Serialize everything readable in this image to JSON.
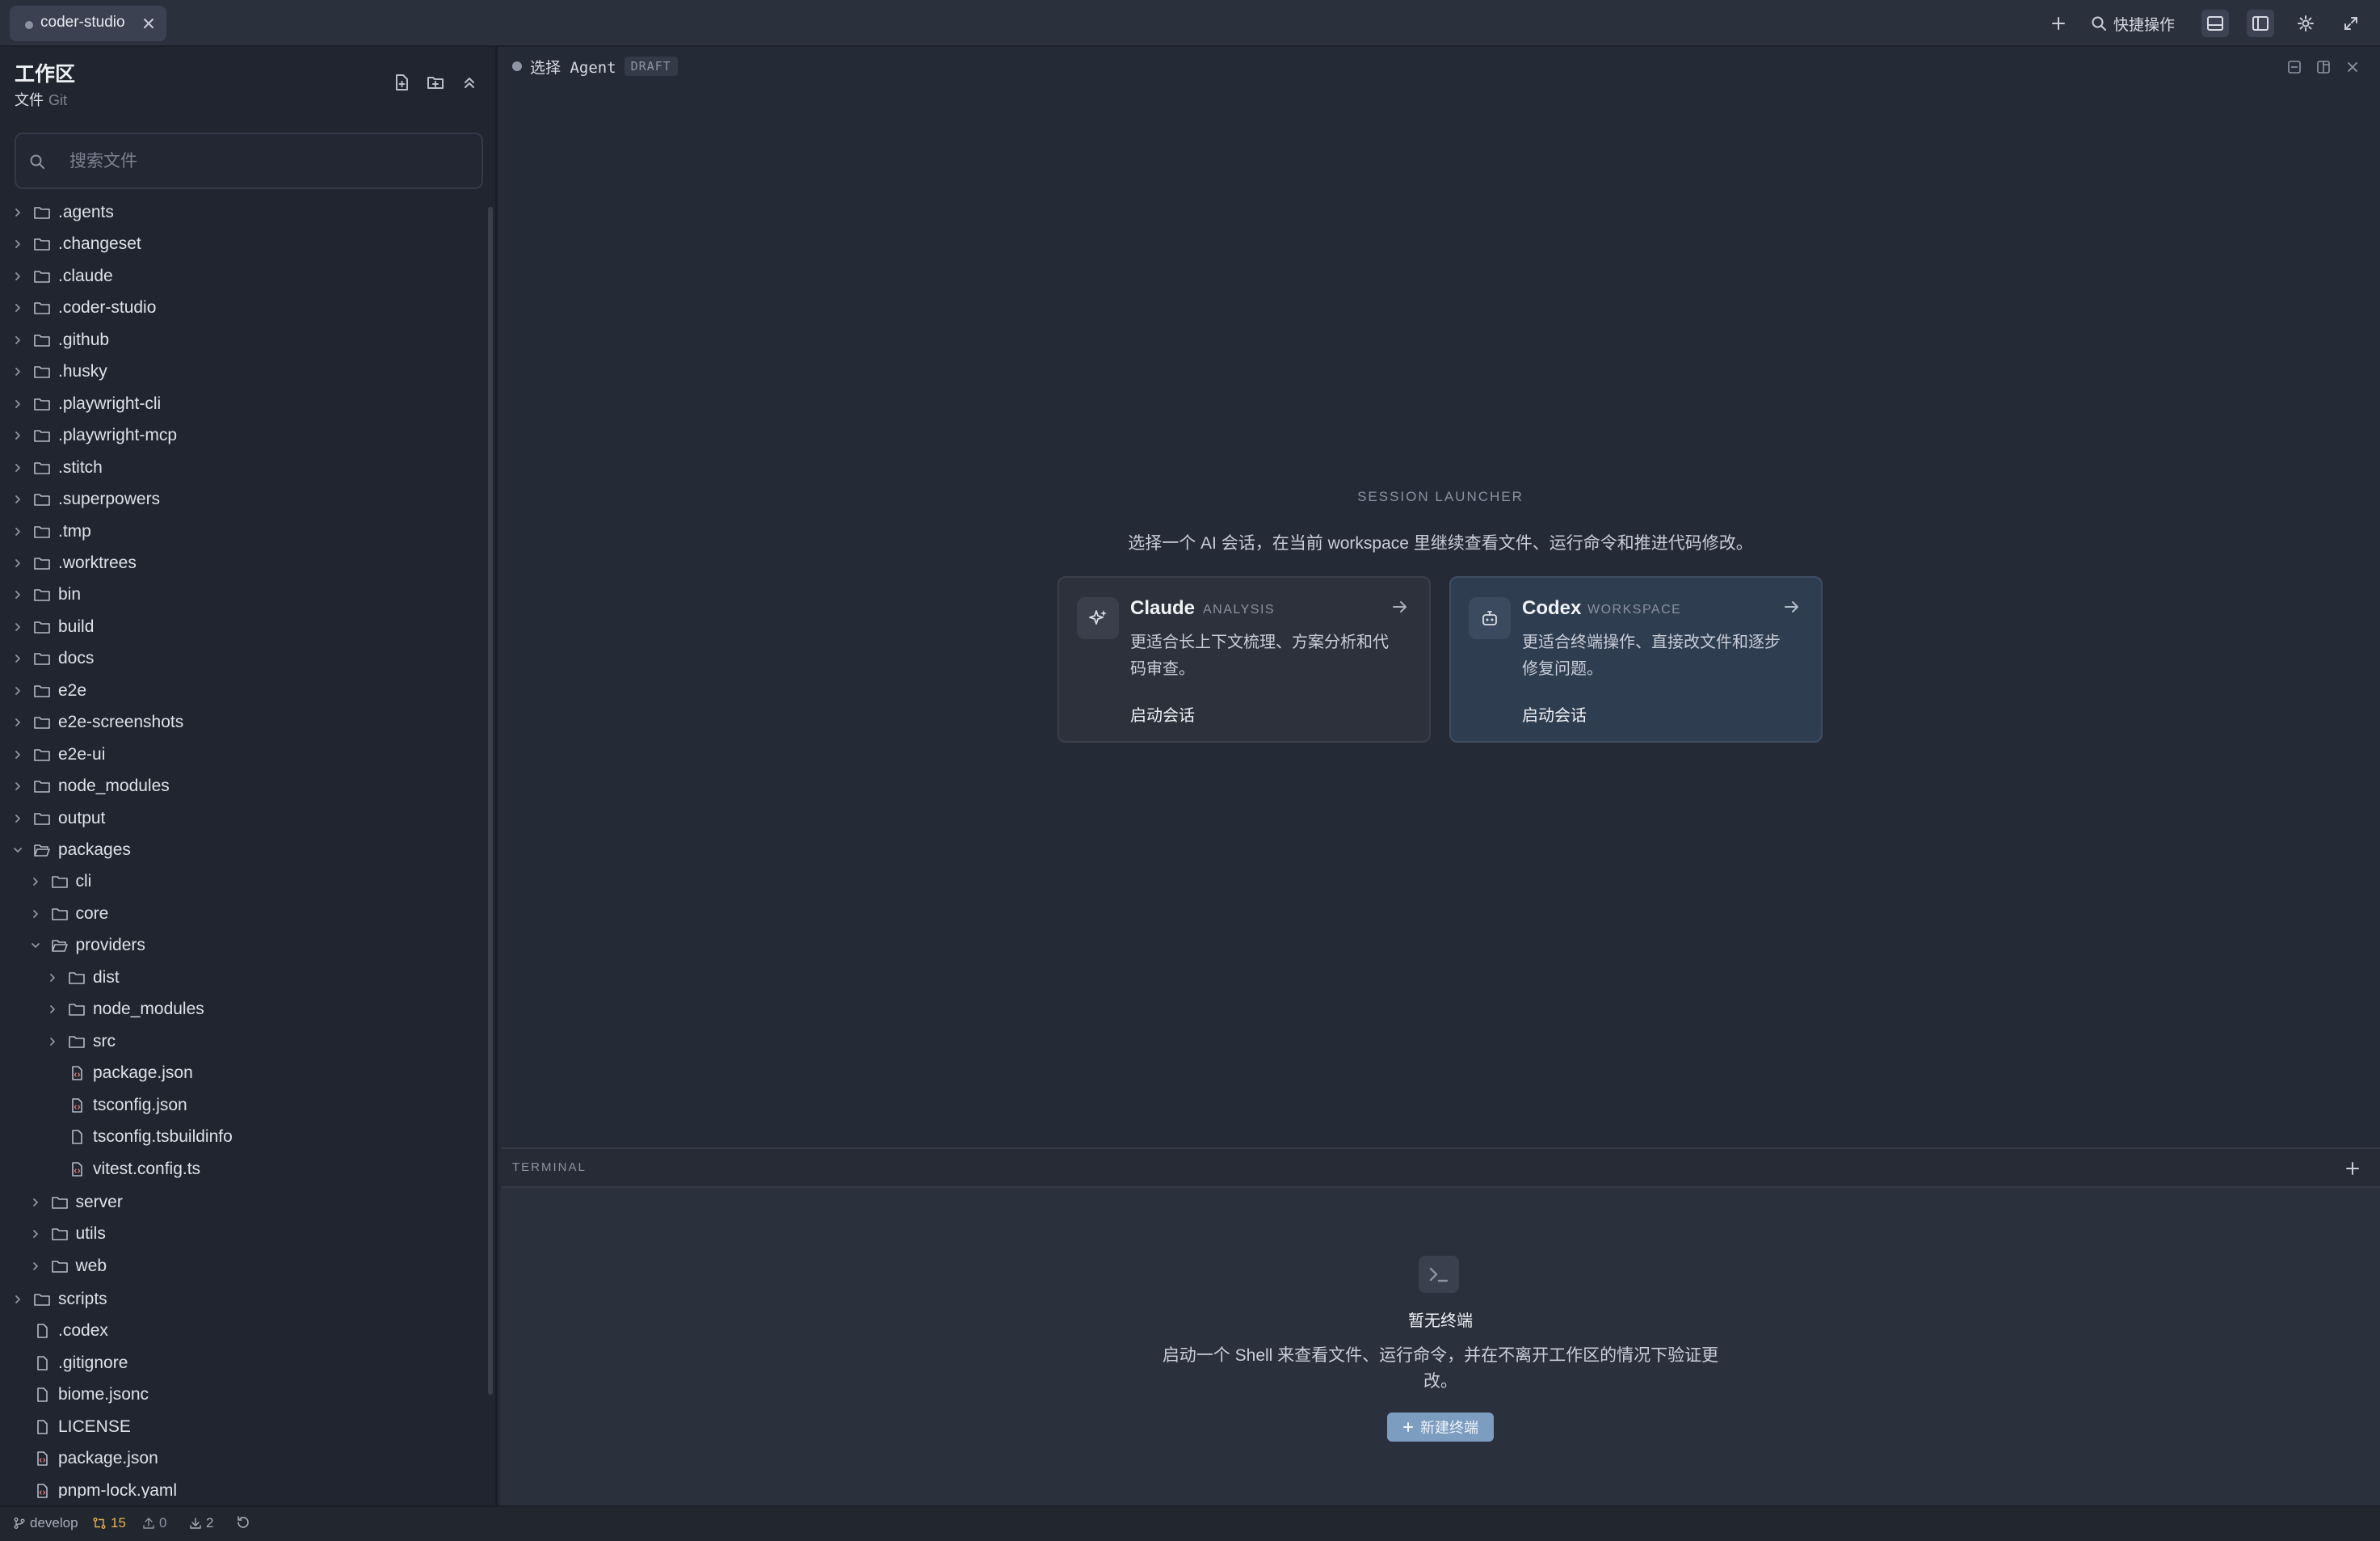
{
  "app": {
    "tab_title": "coder-studio",
    "quick_actions_label": "快捷操作"
  },
  "sidebar": {
    "title": "工作区",
    "subtitle": "文件",
    "subtitle_secondary": "Git",
    "search_placeholder": "搜索文件",
    "tree": [
      {
        "name": ".agents",
        "type": "folder",
        "depth": 0,
        "expanded": false
      },
      {
        "name": ".changeset",
        "type": "folder",
        "depth": 0,
        "expanded": false
      },
      {
        "name": ".claude",
        "type": "folder",
        "depth": 0,
        "expanded": false
      },
      {
        "name": ".coder-studio",
        "type": "folder",
        "depth": 0,
        "expanded": false
      },
      {
        "name": ".github",
        "type": "folder",
        "depth": 0,
        "expanded": false
      },
      {
        "name": ".husky",
        "type": "folder",
        "depth": 0,
        "expanded": false
      },
      {
        "name": ".playwright-cli",
        "type": "folder",
        "depth": 0,
        "expanded": false
      },
      {
        "name": ".playwright-mcp",
        "type": "folder",
        "depth": 0,
        "expanded": false
      },
      {
        "name": ".stitch",
        "type": "folder",
        "depth": 0,
        "expanded": false
      },
      {
        "name": ".superpowers",
        "type": "folder",
        "depth": 0,
        "expanded": false
      },
      {
        "name": ".tmp",
        "type": "folder",
        "depth": 0,
        "expanded": false
      },
      {
        "name": ".worktrees",
        "type": "folder",
        "depth": 0,
        "expanded": false
      },
      {
        "name": "bin",
        "type": "folder",
        "depth": 0,
        "expanded": false
      },
      {
        "name": "build",
        "type": "folder",
        "depth": 0,
        "expanded": false
      },
      {
        "name": "docs",
        "type": "folder",
        "depth": 0,
        "expanded": false
      },
      {
        "name": "e2e",
        "type": "folder",
        "depth": 0,
        "expanded": false
      },
      {
        "name": "e2e-screenshots",
        "type": "folder",
        "depth": 0,
        "expanded": false
      },
      {
        "name": "e2e-ui",
        "type": "folder",
        "depth": 0,
        "expanded": false
      },
      {
        "name": "node_modules",
        "type": "folder",
        "depth": 0,
        "expanded": false
      },
      {
        "name": "output",
        "type": "folder",
        "depth": 0,
        "expanded": false
      },
      {
        "name": "packages",
        "type": "folder",
        "depth": 0,
        "expanded": true
      },
      {
        "name": "cli",
        "type": "folder",
        "depth": 1,
        "expanded": false
      },
      {
        "name": "core",
        "type": "folder",
        "depth": 1,
        "expanded": false
      },
      {
        "name": "providers",
        "type": "folder",
        "depth": 1,
        "expanded": true
      },
      {
        "name": "dist",
        "type": "folder",
        "depth": 2,
        "expanded": false
      },
      {
        "name": "node_modules",
        "type": "folder",
        "depth": 2,
        "expanded": false
      },
      {
        "name": "src",
        "type": "folder",
        "depth": 2,
        "expanded": false
      },
      {
        "name": "package.json",
        "type": "code-file",
        "depth": 2
      },
      {
        "name": "tsconfig.json",
        "type": "code-file",
        "depth": 2
      },
      {
        "name": "tsconfig.tsbuildinfo",
        "type": "file",
        "depth": 2
      },
      {
        "name": "vitest.config.ts",
        "type": "code-file",
        "depth": 2
      },
      {
        "name": "server",
        "type": "folder",
        "depth": 1,
        "expanded": false
      },
      {
        "name": "utils",
        "type": "folder",
        "depth": 1,
        "expanded": false
      },
      {
        "name": "web",
        "type": "folder",
        "depth": 1,
        "expanded": false
      },
      {
        "name": "scripts",
        "type": "folder",
        "depth": 0,
        "expanded": false
      },
      {
        "name": ".codex",
        "type": "file",
        "depth": 0
      },
      {
        "name": ".gitignore",
        "type": "file",
        "depth": 0
      },
      {
        "name": "biome.jsonc",
        "type": "file",
        "depth": 0
      },
      {
        "name": "LICENSE",
        "type": "file",
        "depth": 0
      },
      {
        "name": "package.json",
        "type": "code-file",
        "depth": 0
      },
      {
        "name": "pnpm-lock.yaml",
        "type": "code-file",
        "depth": 0
      }
    ]
  },
  "editor": {
    "agent_label": "选择 Agent",
    "draft_badge": "DRAFT"
  },
  "launcher": {
    "eyebrow": "SESSION LAUNCHER",
    "description": "选择一个 AI 会话，在当前 workspace 里继续查看文件、运行命令和推进代码修改。",
    "cards": [
      {
        "name": "Claude",
        "tag": "ANALYSIS",
        "description": "更适合长上下文梳理、方案分析和代码审查。",
        "action": "启动会话"
      },
      {
        "name": "Codex",
        "tag": "WORKSPACE",
        "description": "更适合终端操作、直接改文件和逐步修复问题。",
        "action": "启动会话"
      }
    ]
  },
  "terminal": {
    "header": "TERMINAL",
    "empty_title": "暂无终端",
    "empty_description": "启动一个 Shell 来查看文件、运行命令，并在不离开工作区的情况下验证更改。",
    "new_button": "新建终端"
  },
  "status_bar": {
    "branch": "develop",
    "changes": "15",
    "ahead": "0",
    "behind": "2"
  },
  "colors": {
    "background": "#252a37",
    "sidebar": "#21252f",
    "accent_button": "#7c9cc0",
    "codex_card": "#2f3d51",
    "warning": "#e3b453"
  }
}
